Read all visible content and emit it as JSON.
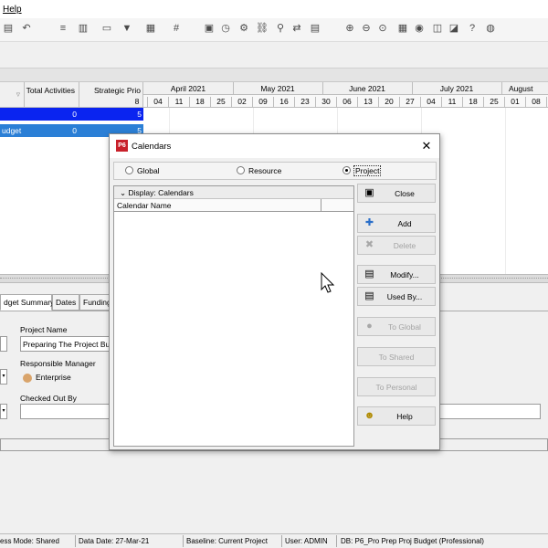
{
  "menu": {
    "help_label": "Help"
  },
  "grid": {
    "columns": {
      "total_activities": "Total Activities",
      "strategic_priority": "Strategic Prio"
    },
    "rows": [
      {
        "name": "",
        "total_activities": "0",
        "strategic_priority": "5"
      },
      {
        "name": "udget",
        "total_activities": "0",
        "strategic_priority": "5"
      }
    ],
    "row_colors": {
      "selected": "#0a24f0",
      "secondary": "#2b7fd6"
    }
  },
  "gantt": {
    "months": [
      "April 2021",
      "May 2021",
      "June 2021",
      "July 2021",
      "August"
    ],
    "weeks": [
      "8",
      "04",
      "11",
      "18",
      "25",
      "02",
      "09",
      "16",
      "23",
      "30",
      "06",
      "13",
      "20",
      "27",
      "04",
      "11",
      "18",
      "25",
      "01",
      "08"
    ]
  },
  "details": {
    "tabs": [
      "dget Summary",
      "Dates",
      "Funding"
    ],
    "project_name_label": "Project Name",
    "project_name_value": "Preparing The Project Bu",
    "responsible_manager_label": "Responsible Manager",
    "responsible_manager_value": "Enterprise",
    "checked_out_by_label": "Checked Out By",
    "checked_out_by_value": ""
  },
  "status_bar": {
    "access_mode": "ess Mode: Shared",
    "data_date": "Data Date: 27-Mar-21",
    "baseline": "Baseline: Current Project",
    "user": "User: ADMIN",
    "db": "DB: P6_Pro Prep Proj Budget (Professional)"
  },
  "dialog": {
    "logo": "P6",
    "title": "Calendars",
    "radios": [
      {
        "label": "Global",
        "checked": false
      },
      {
        "label": "Resource",
        "checked": false
      },
      {
        "label": "Project",
        "checked": true
      }
    ],
    "display_label": "Display: Calendars",
    "column_header": "Calendar Name",
    "buttons": [
      {
        "label": "Close",
        "icon": "close-door-icon",
        "enabled": true
      },
      {
        "label": "Add",
        "icon": "add-icon",
        "enabled": true
      },
      {
        "label": "Delete",
        "icon": "delete-x-icon",
        "enabled": false
      },
      {
        "label": "Modify...",
        "icon": "modify-icon",
        "enabled": true
      },
      {
        "label": "Used By...",
        "icon": "used-by-icon",
        "enabled": true
      },
      {
        "label": "To Global",
        "icon": "globe-icon",
        "enabled": false
      },
      {
        "label": "To Shared",
        "icon": "",
        "enabled": false
      },
      {
        "label": "To Personal",
        "icon": "",
        "enabled": false
      },
      {
        "label": "Help",
        "icon": "help-icon",
        "enabled": true
      }
    ]
  }
}
